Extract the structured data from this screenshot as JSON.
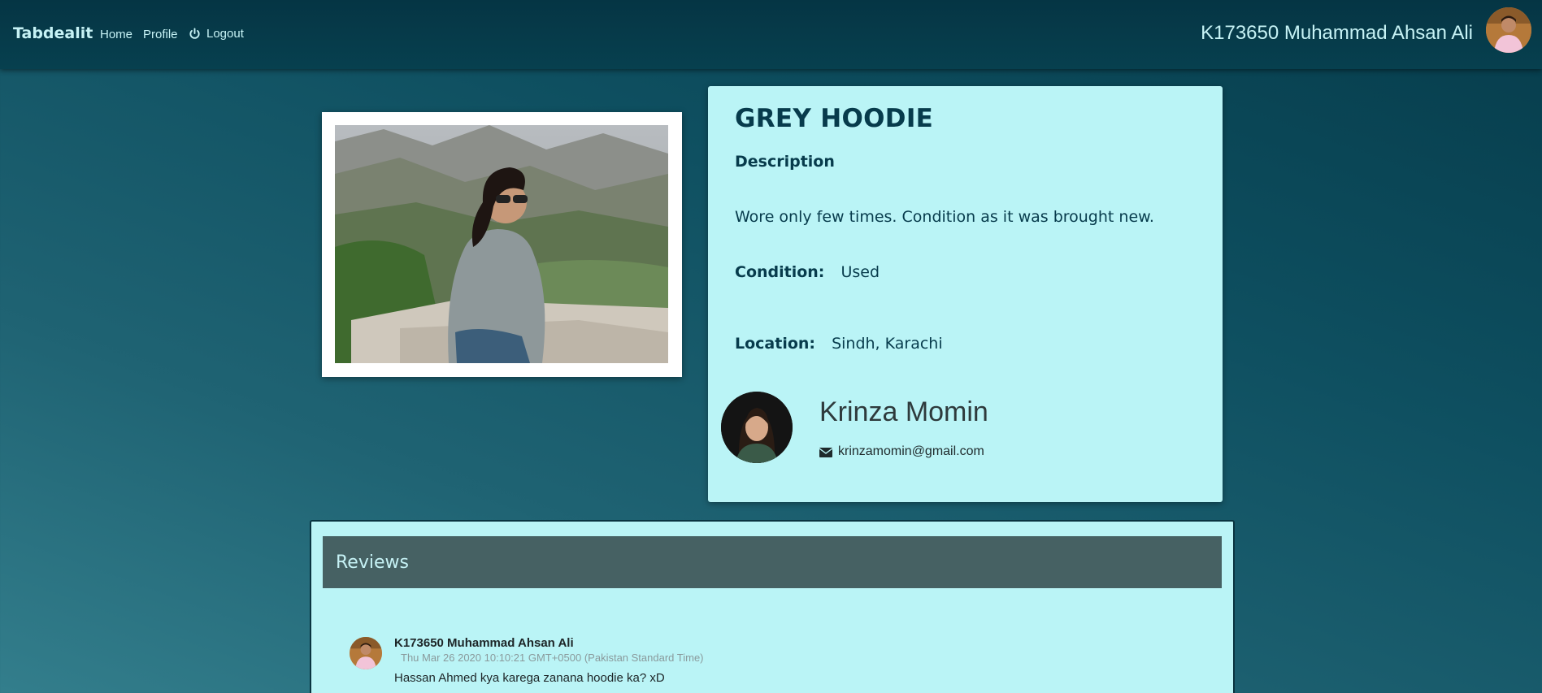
{
  "navbar": {
    "brand": "Tabdealit",
    "links": {
      "home": "Home",
      "profile": "Profile",
      "logout": "Logout"
    },
    "user_name": "K173650 Muhammad Ahsan Ali"
  },
  "product": {
    "title": "GREY HOODIE",
    "description_label": "Description",
    "description": "Wore only few times. Condition as it was brought new.",
    "condition_label": "Condition:",
    "condition": "Used",
    "location_label": "Location:",
    "location": "Sindh, Karachi"
  },
  "seller": {
    "name": "Krinza Momin",
    "email": "krinzamomin@gmail.com"
  },
  "reviews": {
    "header": "Reviews",
    "items": [
      {
        "author": "K173650 Muhammad Ahsan Ali",
        "date": "Thu Mar 26 2020 10:10:21 GMT+0500 (Pakistan Standard Time)",
        "text": "Hassan Ahmed kya karega zanana hoodie ka? xD"
      }
    ]
  },
  "colors": {
    "accent_text": "#c6f2f5",
    "card_bg": "#baf4f6",
    "reviews_header_bg": "#466163",
    "dark_teal": "#073b4c"
  },
  "icons": {
    "logout": "power-icon",
    "email": "envelope-icon"
  }
}
